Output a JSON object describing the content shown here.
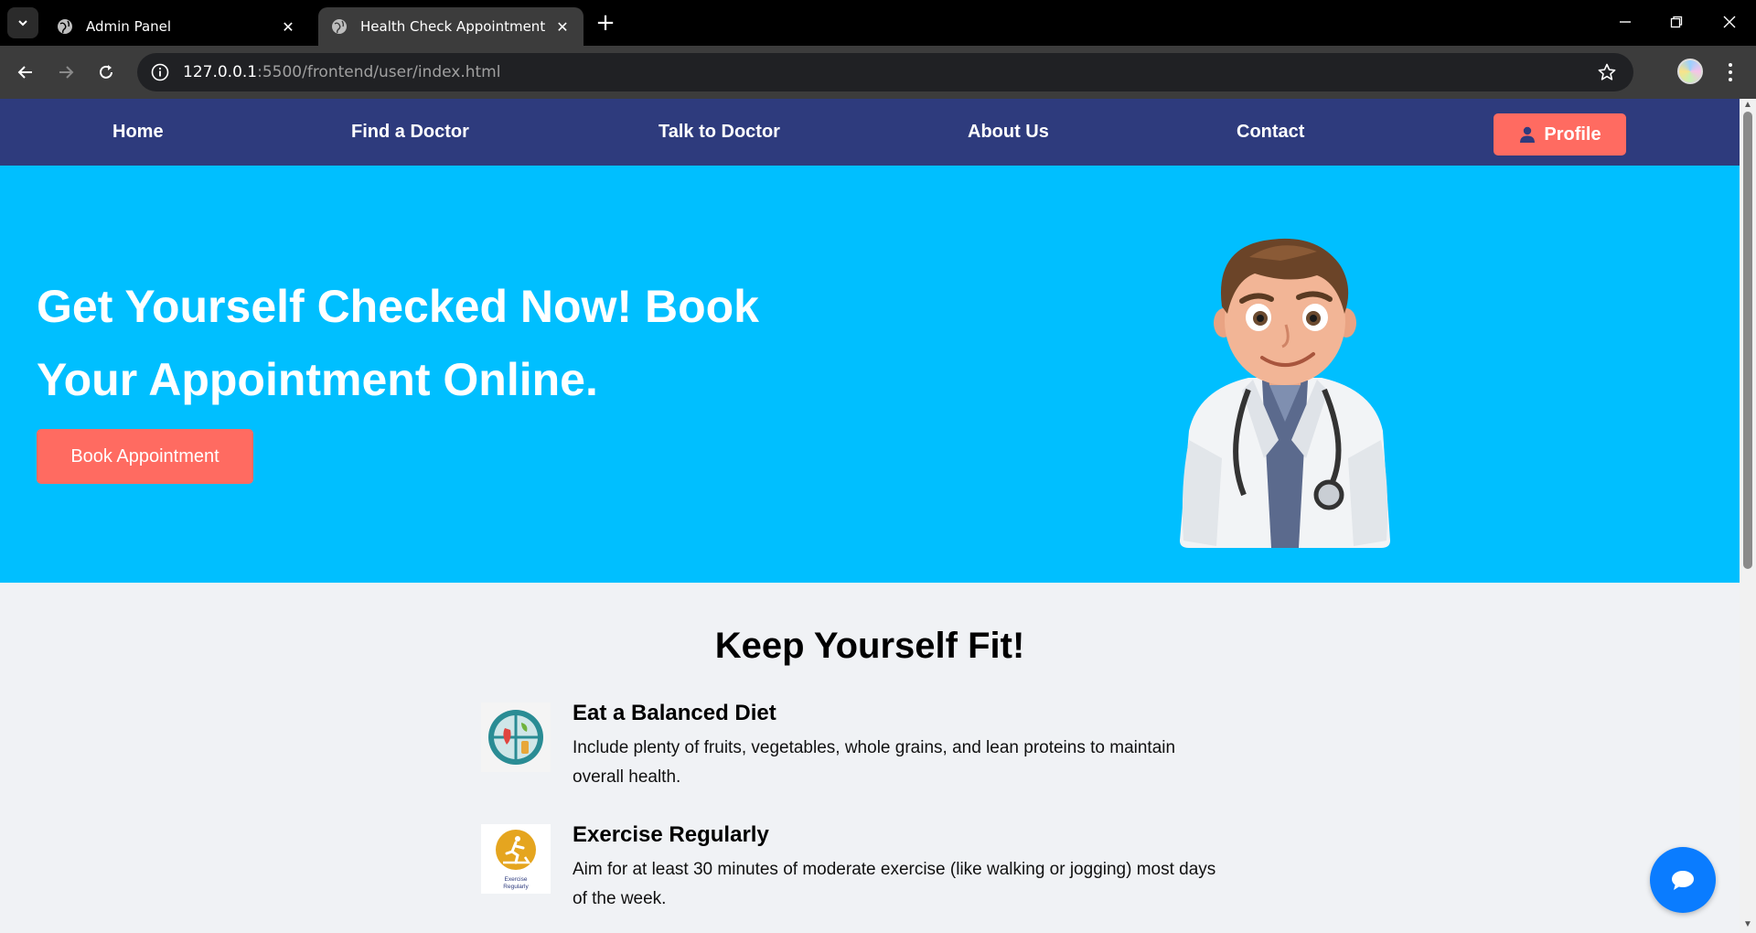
{
  "browser": {
    "tabs": [
      {
        "title": "Admin Panel",
        "active": false
      },
      {
        "title": "Health Check Appointment",
        "active": true
      }
    ],
    "new_tab": "+",
    "url_host": "127.0.0.1",
    "url_path": ":5500/frontend/user/index.html"
  },
  "site_nav": {
    "links": [
      "Home",
      "Find a Doctor",
      "Talk to Doctor",
      "About Us",
      "Contact"
    ],
    "profile_label": "Profile"
  },
  "hero": {
    "headline_line1": "Get Yourself Checked Now! Book",
    "headline_line2": "Your Appointment Online.",
    "button_label": "Book Appointment"
  },
  "fit": {
    "title": "Keep Yourself Fit!",
    "tips": [
      {
        "title": "Eat a Balanced Diet",
        "text_line1": "Include plenty of fruits, vegetables, whole grains, and lean proteins to maintain",
        "text_line2": "overall health.",
        "icon": "balanced-diet-icon"
      },
      {
        "title": "Exercise Regularly",
        "text_line1": "Aim for at least 30 minutes of moderate exercise (like walking or jogging) most days",
        "text_line2": "of the week.",
        "icon": "exercise-icon",
        "icon_caption_1": "Exercise",
        "icon_caption_2": "Regularly"
      }
    ]
  },
  "colors": {
    "nav_bg": "#2e3b7d",
    "hero_bg": "#00bfff",
    "accent": "#ff6b61",
    "chat_fab": "#0a7cff"
  }
}
